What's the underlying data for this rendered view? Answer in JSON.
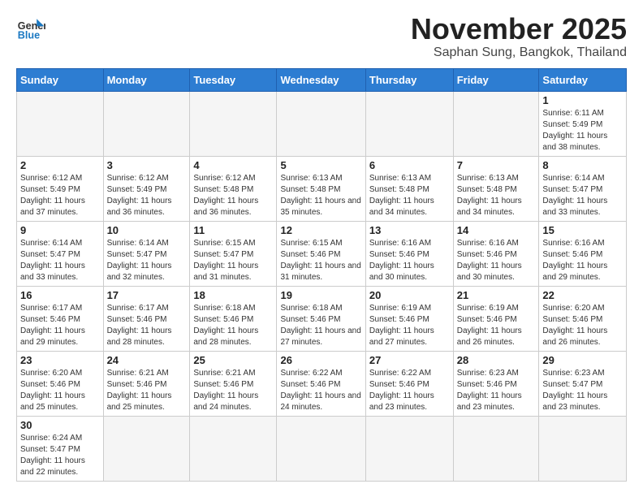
{
  "header": {
    "logo_general": "General",
    "logo_blue": "Blue",
    "month": "November 2025",
    "location": "Saphan Sung, Bangkok, Thailand"
  },
  "days_of_week": [
    "Sunday",
    "Monday",
    "Tuesday",
    "Wednesday",
    "Thursday",
    "Friday",
    "Saturday"
  ],
  "weeks": [
    [
      {
        "day": "",
        "info": ""
      },
      {
        "day": "",
        "info": ""
      },
      {
        "day": "",
        "info": ""
      },
      {
        "day": "",
        "info": ""
      },
      {
        "day": "",
        "info": ""
      },
      {
        "day": "",
        "info": ""
      },
      {
        "day": "1",
        "info": "Sunrise: 6:11 AM\nSunset: 5:49 PM\nDaylight: 11 hours and 38 minutes."
      }
    ],
    [
      {
        "day": "2",
        "info": "Sunrise: 6:12 AM\nSunset: 5:49 PM\nDaylight: 11 hours and 37 minutes."
      },
      {
        "day": "3",
        "info": "Sunrise: 6:12 AM\nSunset: 5:49 PM\nDaylight: 11 hours and 36 minutes."
      },
      {
        "day": "4",
        "info": "Sunrise: 6:12 AM\nSunset: 5:48 PM\nDaylight: 11 hours and 36 minutes."
      },
      {
        "day": "5",
        "info": "Sunrise: 6:13 AM\nSunset: 5:48 PM\nDaylight: 11 hours and 35 minutes."
      },
      {
        "day": "6",
        "info": "Sunrise: 6:13 AM\nSunset: 5:48 PM\nDaylight: 11 hours and 34 minutes."
      },
      {
        "day": "7",
        "info": "Sunrise: 6:13 AM\nSunset: 5:48 PM\nDaylight: 11 hours and 34 minutes."
      },
      {
        "day": "8",
        "info": "Sunrise: 6:14 AM\nSunset: 5:47 PM\nDaylight: 11 hours and 33 minutes."
      }
    ],
    [
      {
        "day": "9",
        "info": "Sunrise: 6:14 AM\nSunset: 5:47 PM\nDaylight: 11 hours and 33 minutes."
      },
      {
        "day": "10",
        "info": "Sunrise: 6:14 AM\nSunset: 5:47 PM\nDaylight: 11 hours and 32 minutes."
      },
      {
        "day": "11",
        "info": "Sunrise: 6:15 AM\nSunset: 5:47 PM\nDaylight: 11 hours and 31 minutes."
      },
      {
        "day": "12",
        "info": "Sunrise: 6:15 AM\nSunset: 5:46 PM\nDaylight: 11 hours and 31 minutes."
      },
      {
        "day": "13",
        "info": "Sunrise: 6:16 AM\nSunset: 5:46 PM\nDaylight: 11 hours and 30 minutes."
      },
      {
        "day": "14",
        "info": "Sunrise: 6:16 AM\nSunset: 5:46 PM\nDaylight: 11 hours and 30 minutes."
      },
      {
        "day": "15",
        "info": "Sunrise: 6:16 AM\nSunset: 5:46 PM\nDaylight: 11 hours and 29 minutes."
      }
    ],
    [
      {
        "day": "16",
        "info": "Sunrise: 6:17 AM\nSunset: 5:46 PM\nDaylight: 11 hours and 29 minutes."
      },
      {
        "day": "17",
        "info": "Sunrise: 6:17 AM\nSunset: 5:46 PM\nDaylight: 11 hours and 28 minutes."
      },
      {
        "day": "18",
        "info": "Sunrise: 6:18 AM\nSunset: 5:46 PM\nDaylight: 11 hours and 28 minutes."
      },
      {
        "day": "19",
        "info": "Sunrise: 6:18 AM\nSunset: 5:46 PM\nDaylight: 11 hours and 27 minutes."
      },
      {
        "day": "20",
        "info": "Sunrise: 6:19 AM\nSunset: 5:46 PM\nDaylight: 11 hours and 27 minutes."
      },
      {
        "day": "21",
        "info": "Sunrise: 6:19 AM\nSunset: 5:46 PM\nDaylight: 11 hours and 26 minutes."
      },
      {
        "day": "22",
        "info": "Sunrise: 6:20 AM\nSunset: 5:46 PM\nDaylight: 11 hours and 26 minutes."
      }
    ],
    [
      {
        "day": "23",
        "info": "Sunrise: 6:20 AM\nSunset: 5:46 PM\nDaylight: 11 hours and 25 minutes."
      },
      {
        "day": "24",
        "info": "Sunrise: 6:21 AM\nSunset: 5:46 PM\nDaylight: 11 hours and 25 minutes."
      },
      {
        "day": "25",
        "info": "Sunrise: 6:21 AM\nSunset: 5:46 PM\nDaylight: 11 hours and 24 minutes."
      },
      {
        "day": "26",
        "info": "Sunrise: 6:22 AM\nSunset: 5:46 PM\nDaylight: 11 hours and 24 minutes."
      },
      {
        "day": "27",
        "info": "Sunrise: 6:22 AM\nSunset: 5:46 PM\nDaylight: 11 hours and 23 minutes."
      },
      {
        "day": "28",
        "info": "Sunrise: 6:23 AM\nSunset: 5:46 PM\nDaylight: 11 hours and 23 minutes."
      },
      {
        "day": "29",
        "info": "Sunrise: 6:23 AM\nSunset: 5:47 PM\nDaylight: 11 hours and 23 minutes."
      }
    ],
    [
      {
        "day": "30",
        "info": "Sunrise: 6:24 AM\nSunset: 5:47 PM\nDaylight: 11 hours and 22 minutes."
      },
      {
        "day": "",
        "info": ""
      },
      {
        "day": "",
        "info": ""
      },
      {
        "day": "",
        "info": ""
      },
      {
        "day": "",
        "info": ""
      },
      {
        "day": "",
        "info": ""
      },
      {
        "day": "",
        "info": ""
      }
    ]
  ]
}
